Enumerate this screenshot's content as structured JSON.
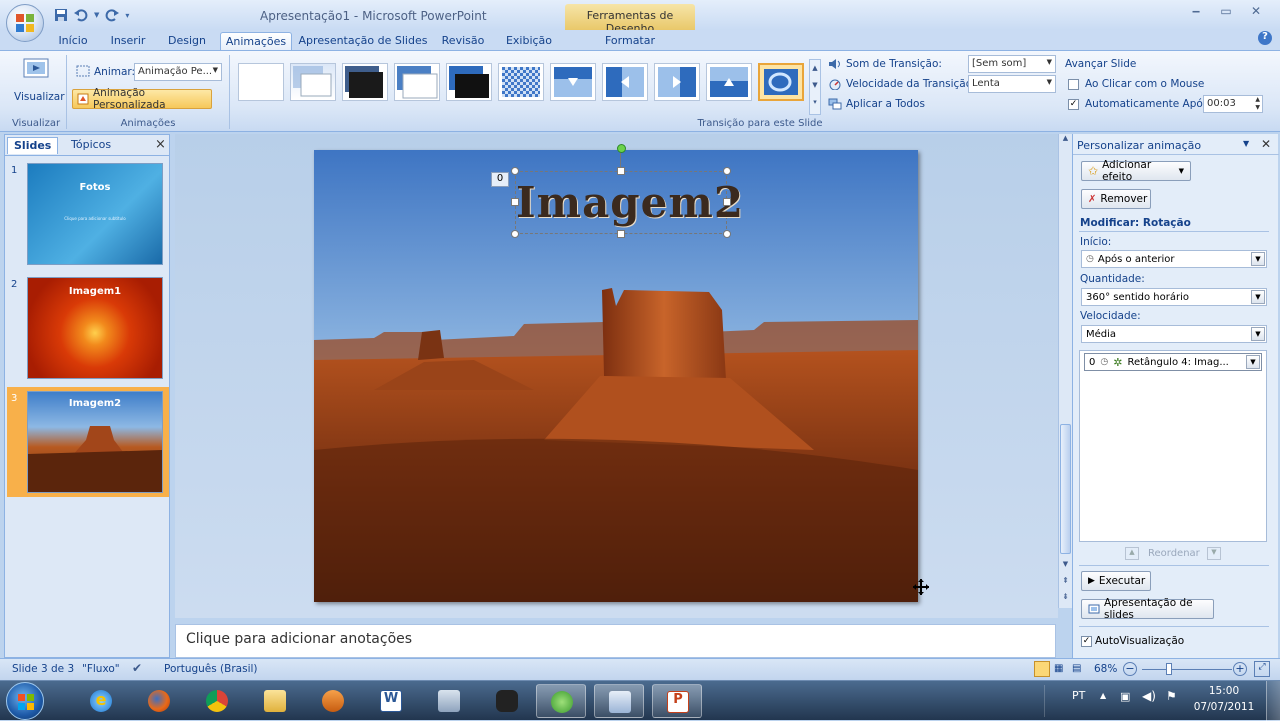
{
  "window": {
    "title": "Apresentação1 - Microsoft PowerPoint",
    "contextual_tab": "Ferramentas de Desenho",
    "minimize": "‒",
    "maximize": "▭",
    "close": "✕"
  },
  "tabs": [
    "Início",
    "Inserir",
    "Design",
    "Animações",
    "Apresentação de Slides",
    "Revisão",
    "Exibição",
    "Formatar"
  ],
  "active_tab": "Animações",
  "ribbon": {
    "preview_label": "Visualizar",
    "preview_group": "Visualizar",
    "animate_label": "Animar:",
    "animate_value": "Animação Pe...",
    "custom_animation": "Animação Personalizada",
    "animations_group": "Animações",
    "transition_group": "Transição para este Slide",
    "sound_label": "Som de Transição:",
    "sound_value": "[Sem som]",
    "speed_label": "Velocidade da Transição:",
    "speed_value": "Lenta",
    "apply_all": "Aplicar a Todos",
    "advance_title": "Avançar Slide",
    "on_click": "Ao Clicar com o Mouse",
    "on_click_checked": false,
    "auto_after": "Automaticamente Após:",
    "auto_after_checked": true,
    "auto_time": "00:03"
  },
  "left_pane": {
    "tab_slides": "Slides",
    "tab_outline": "Tópicos",
    "close": "×",
    "thumbs": [
      {
        "num": "1",
        "title": "Fotos",
        "subtitle": "Clique para adicionar subtítulo"
      },
      {
        "num": "2",
        "title": "Imagem1"
      },
      {
        "num": "3",
        "title": "Imagem2"
      }
    ]
  },
  "slide": {
    "title": "Imagem2",
    "anim_tag": "0"
  },
  "notes_placeholder": "Clique para adicionar anotações",
  "task_pane": {
    "title": "Personalizar animação",
    "add_effect": "Adicionar efeito",
    "remove": "Remover",
    "modify_title": "Modificar: Rotação",
    "start_label": "Início:",
    "start_value": "Após o anterior",
    "amount_label": "Quantidade:",
    "amount_value": "360° sentido horário",
    "speed_label": "Velocidade:",
    "speed_value": "Média",
    "list_item_num": "0",
    "list_item": "Retângulo 4: Imag...",
    "reorder": "Reordenar",
    "play": "Executar",
    "slideshow": "Apresentação de slides",
    "autopreview": "AutoVisualização",
    "autopreview_checked": true
  },
  "status": {
    "slide_of": "Slide 3 de 3",
    "theme": "\"Fluxo\"",
    "language": "Português (Brasil)",
    "zoom": "68%"
  },
  "taskbar": {
    "lang": "PT",
    "time": "15:00",
    "date": "07/07/2011"
  },
  "colors": {
    "ribbon_blue": "#15428b",
    "contextual_gold": "#e9c86a",
    "selected_thumb": "#f8b04a"
  }
}
